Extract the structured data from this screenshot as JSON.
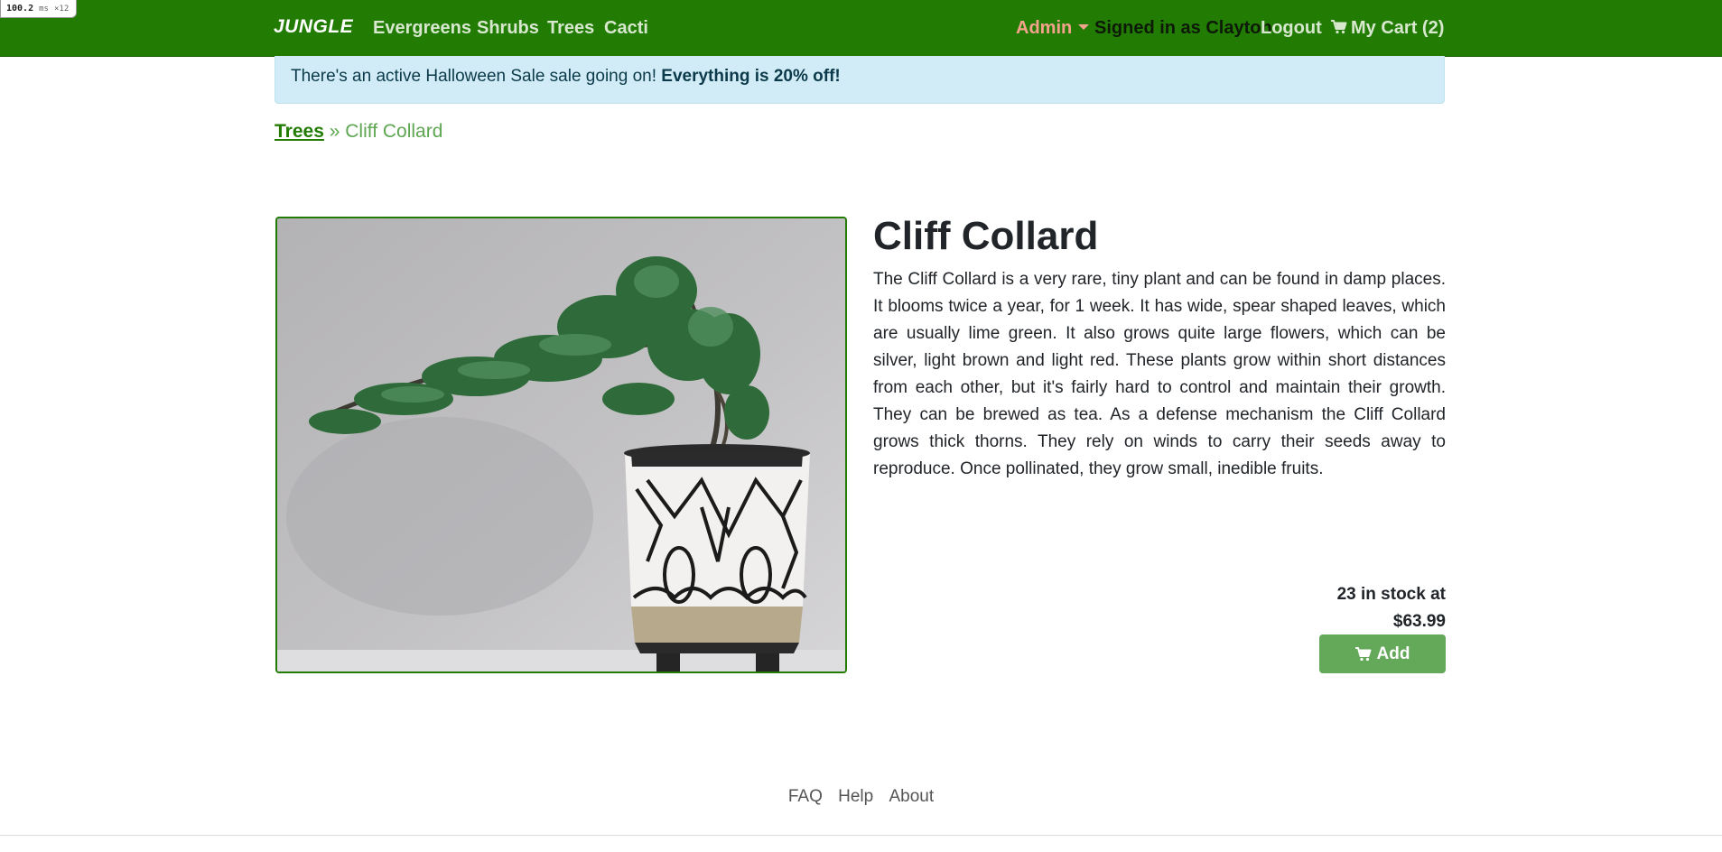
{
  "perf": {
    "value": "100.2",
    "unit": "ms",
    "multiplier": "×12"
  },
  "nav": {
    "brand": "JUNGLE",
    "links": [
      "Evergreens",
      "Shrubs",
      "Trees",
      "Cacti"
    ],
    "admin": "Admin",
    "signed_in": "Signed in as Clayton",
    "logout": "Logout",
    "cart": "My Cart (2)"
  },
  "alert": {
    "text": "There's an active Halloween Sale sale going on! ",
    "bold": "Everything is 20% off!"
  },
  "breadcrumb": {
    "category": "Trees",
    "separator": "»",
    "current": "Cliff Collard"
  },
  "product": {
    "name": "Cliff Collard",
    "description": "The Cliff Collard is a very rare, tiny plant and can be found in damp places. It blooms twice a year, for 1 week. It has wide, spear shaped leaves, which are usually lime green. It also grows quite large flowers, which can be silver, light brown and light red. These plants grow within short distances from each other, but it's fairly hard to control and maintain their growth. They can be brewed as tea. As a defense mechanism the Cliff Collard grows thick thorns. They rely on winds to carry their seeds away to reproduce. Once pollinated, they grow small, inedible fruits.",
    "stock_line": "23 in stock at",
    "price": "$63.99",
    "add_label": "Add"
  },
  "footer": {
    "links": [
      "FAQ",
      "Help",
      "About"
    ]
  },
  "colors": {
    "navbar": "#227c04",
    "alert_bg": "#d1ecf6",
    "button": "#64a85a",
    "admin": "#f5a38c"
  },
  "icons": {
    "cart": "shopping-cart-icon",
    "caret": "caret-down-icon"
  }
}
